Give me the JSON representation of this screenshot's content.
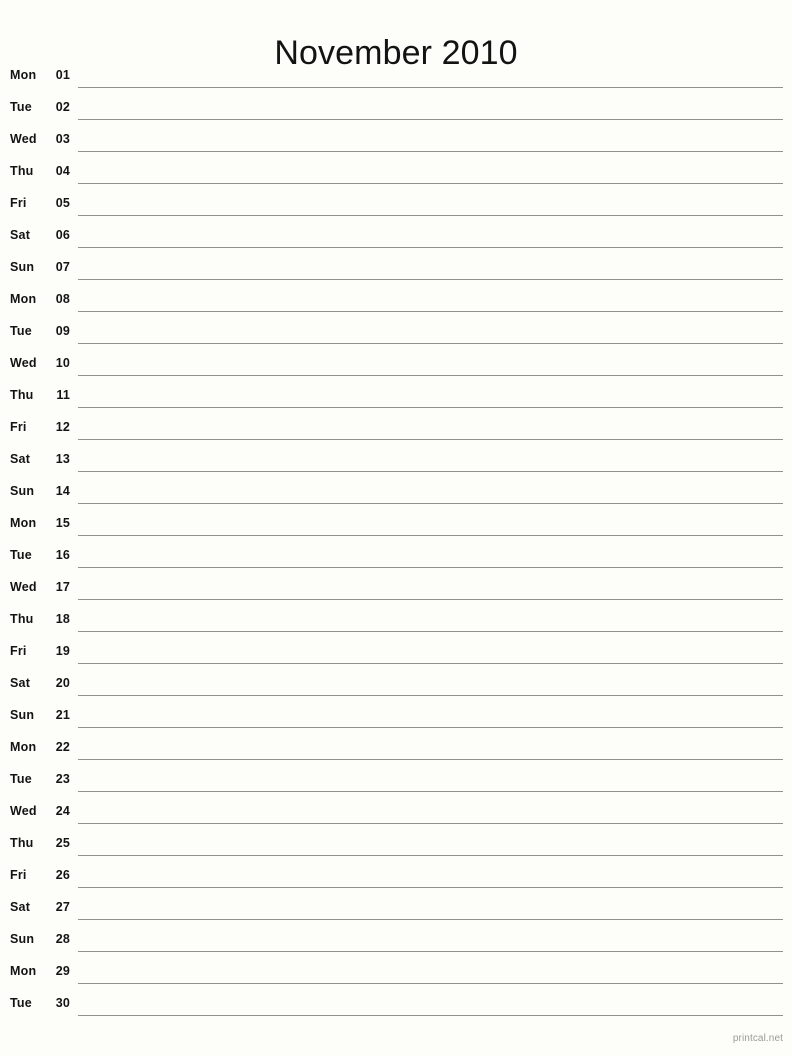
{
  "document": {
    "type": "printable-calendar",
    "title": "November 2010",
    "month": "November",
    "year": "2010"
  },
  "colors": {
    "page_background": "#fdfdfa",
    "text": "#131313",
    "rule_line": "#8f918c",
    "footer_text": "#9a9a96"
  },
  "rows": [
    {
      "weekday": "Mon",
      "day": "01"
    },
    {
      "weekday": "Tue",
      "day": "02"
    },
    {
      "weekday": "Wed",
      "day": "03"
    },
    {
      "weekday": "Thu",
      "day": "04"
    },
    {
      "weekday": "Fri",
      "day": "05"
    },
    {
      "weekday": "Sat",
      "day": "06"
    },
    {
      "weekday": "Sun",
      "day": "07"
    },
    {
      "weekday": "Mon",
      "day": "08"
    },
    {
      "weekday": "Tue",
      "day": "09"
    },
    {
      "weekday": "Wed",
      "day": "10"
    },
    {
      "weekday": "Thu",
      "day": "11"
    },
    {
      "weekday": "Fri",
      "day": "12"
    },
    {
      "weekday": "Sat",
      "day": "13"
    },
    {
      "weekday": "Sun",
      "day": "14"
    },
    {
      "weekday": "Mon",
      "day": "15"
    },
    {
      "weekday": "Tue",
      "day": "16"
    },
    {
      "weekday": "Wed",
      "day": "17"
    },
    {
      "weekday": "Thu",
      "day": "18"
    },
    {
      "weekday": "Fri",
      "day": "19"
    },
    {
      "weekday": "Sat",
      "day": "20"
    },
    {
      "weekday": "Sun",
      "day": "21"
    },
    {
      "weekday": "Mon",
      "day": "22"
    },
    {
      "weekday": "Tue",
      "day": "23"
    },
    {
      "weekday": "Wed",
      "day": "24"
    },
    {
      "weekday": "Thu",
      "day": "25"
    },
    {
      "weekday": "Fri",
      "day": "26"
    },
    {
      "weekday": "Sat",
      "day": "27"
    },
    {
      "weekday": "Sun",
      "day": "28"
    },
    {
      "weekday": "Mon",
      "day": "29"
    },
    {
      "weekday": "Tue",
      "day": "30"
    }
  ],
  "footer": {
    "credit": "printcal.net"
  }
}
